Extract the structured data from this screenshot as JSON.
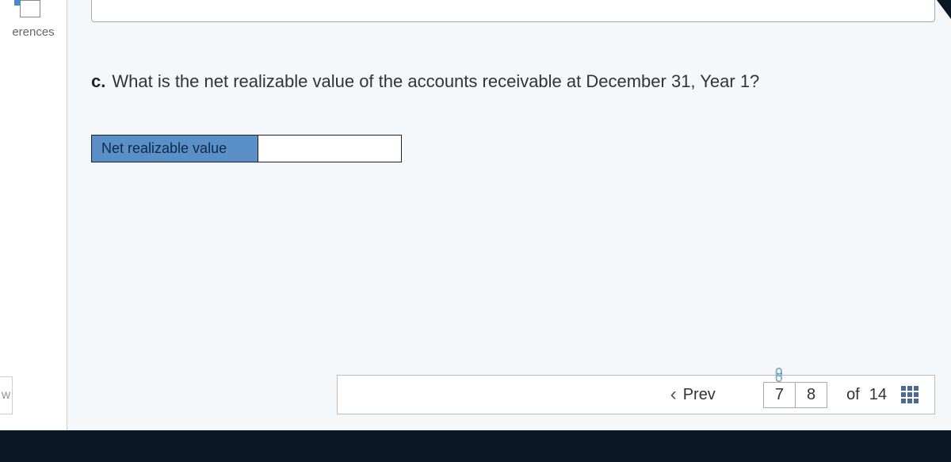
{
  "sidebar": {
    "references_label": "erences"
  },
  "question": {
    "letter": "c.",
    "text": "What is the net realizable value of the accounts receivable at December 31, Year 1?"
  },
  "answer": {
    "label": "Net realizable value",
    "value": ""
  },
  "nav": {
    "prev_label": "Prev",
    "page_current": "7",
    "page_next": "8",
    "of_label": "of",
    "total": "14"
  },
  "misc": {
    "w_label": "W"
  }
}
